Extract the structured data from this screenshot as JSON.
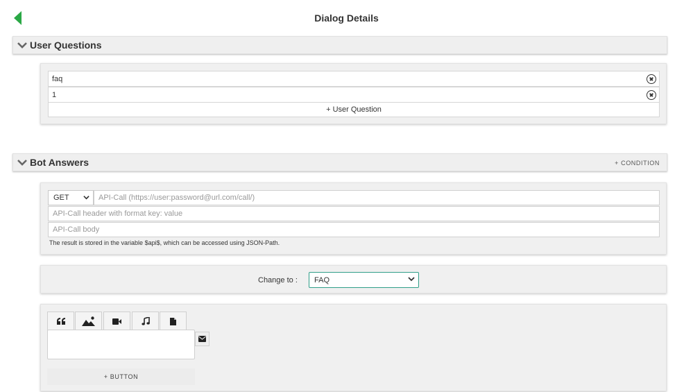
{
  "header": {
    "title": "Dialog Details",
    "back_icon": "back-arrow-icon",
    "accent_color": "#2aa845"
  },
  "user_questions": {
    "title": "User Questions",
    "questions": [
      "faq",
      "1"
    ],
    "add_label": "+ User Question"
  },
  "bot_answers": {
    "title": "Bot Answers",
    "condition_label": "+ CONDITION",
    "api_call": {
      "method": "GET",
      "url_placeholder": "API-Call (https://user:password@url.com/call/)",
      "header_placeholder": "API-Call header with format key: value",
      "body_placeholder": "API-Call body",
      "hint": "The result is stored in the variable $api$, which can be accessed using JSON-Path."
    },
    "change_to": {
      "label": "Change to :",
      "selected": "FAQ"
    },
    "message": {
      "tabs": [
        "quote-icon",
        "image-icon",
        "video-icon",
        "music-icon",
        "file-icon"
      ],
      "add_button_label": "+ BUTTON"
    }
  }
}
